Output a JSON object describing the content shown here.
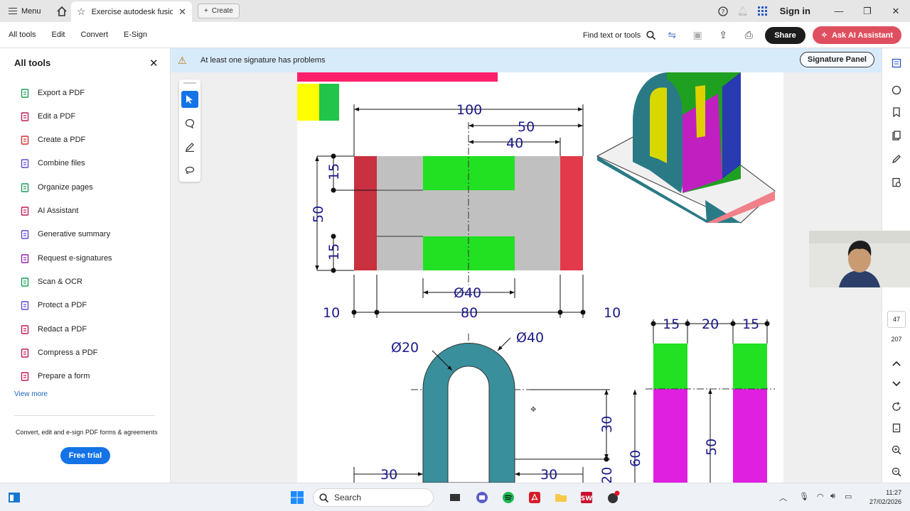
{
  "titlebar": {
    "menu_label": "Menu",
    "tab_title": "Exercise autodesk fusion...",
    "create_label": "Create",
    "signin_label": "Sign in"
  },
  "toolbar": {
    "menus": [
      "All tools",
      "Edit",
      "Convert",
      "E-Sign"
    ],
    "find_label": "Find text or tools",
    "share_label": "Share",
    "ask_ai_label": "Ask AI Assistant"
  },
  "sidebar": {
    "title": "All tools",
    "items": [
      {
        "label": "Export a PDF",
        "icon": "export-pdf-icon",
        "color": "#1a9c5a"
      },
      {
        "label": "Edit a PDF",
        "icon": "edit-pdf-icon",
        "color": "#c2185b"
      },
      {
        "label": "Create a PDF",
        "icon": "create-pdf-icon",
        "color": "#d32f2f"
      },
      {
        "label": "Combine files",
        "icon": "combine-files-icon",
        "color": "#5c4ad6"
      },
      {
        "label": "Organize pages",
        "icon": "organize-pages-icon",
        "color": "#1a9c5a"
      },
      {
        "label": "AI Assistant",
        "icon": "ai-assistant-icon",
        "color": "#c2185b"
      },
      {
        "label": "Generative summary",
        "icon": "generative-summary-icon",
        "color": "#5c4ad6"
      },
      {
        "label": "Request e-signatures",
        "icon": "request-esign-icon",
        "color": "#8e24aa"
      },
      {
        "label": "Scan & OCR",
        "icon": "scan-ocr-icon",
        "color": "#1a9c5a"
      },
      {
        "label": "Protect a PDF",
        "icon": "protect-pdf-icon",
        "color": "#5c4ad6"
      },
      {
        "label": "Redact a PDF",
        "icon": "redact-pdf-icon",
        "color": "#c2185b"
      },
      {
        "label": "Compress a PDF",
        "icon": "compress-pdf-icon",
        "color": "#c2185b"
      },
      {
        "label": "Prepare a form",
        "icon": "prepare-form-icon",
        "color": "#c2185b"
      }
    ],
    "view_more": "View more",
    "promo_text": "Convert, edit and e-sign PDF forms & agreements",
    "free_trial_label": "Free trial"
  },
  "signature_bar": {
    "message": "At least one signature has problems",
    "panel_label": "Signature Panel"
  },
  "drawing": {
    "dims": {
      "d100": "100",
      "d50": "50",
      "d40": "40",
      "d15a": "15",
      "d50v": "50",
      "d15b": "15",
      "dia40": "Ø40",
      "d10l": "10",
      "d80": "80",
      "d10r": "10",
      "dia20": "Ø20",
      "dia40b": "Ø40",
      "d30v": "30",
      "d60": "60",
      "d50b": "50",
      "d30l": "30",
      "d30r": "30",
      "d20": "20",
      "s15a": "15",
      "s20": "20",
      "s15b": "15"
    },
    "colors": {
      "green": "#22e022",
      "gray": "#c0c0c0",
      "red": "#e23a4a",
      "teal": "#3a8f9c",
      "magenta": "#e020e0",
      "yellow": "#ffff00",
      "pink": "#ff1f6a",
      "dimension": "#1a1a8c"
    }
  },
  "rightrail": {
    "page_current": "47",
    "page_total": "207"
  },
  "taskbar": {
    "search_label": "Search",
    "time": "11:27",
    "date": "27/02/2026"
  }
}
